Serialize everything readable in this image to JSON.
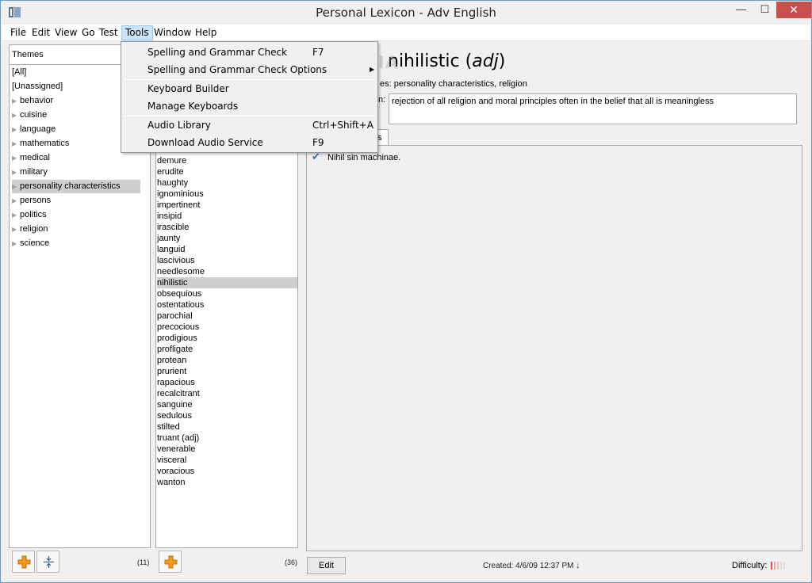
{
  "window": {
    "title": "Personal Lexicon - Adv English",
    "close_glyph": "✕",
    "min_glyph": "—",
    "max_glyph": "☐"
  },
  "menu": [
    "File",
    "Edit",
    "View",
    "Go",
    "Test",
    "Tools",
    "Window",
    "Help"
  ],
  "tools_menu": {
    "items": [
      {
        "label": "Spelling and Grammar Check",
        "shortcut": "F7"
      },
      {
        "label": "Spelling and Grammar Check Options",
        "shortcut": "",
        "submenu": true
      },
      {
        "label": "Keyboard Builder",
        "shortcut": ""
      },
      {
        "label": "Manage Keyboards",
        "shortcut": ""
      },
      {
        "label": "Audio Library",
        "shortcut": "Ctrl+Shift+A"
      },
      {
        "label": "Download Audio Service",
        "shortcut": "F9"
      }
    ],
    "submenu_glyph": "▶"
  },
  "themes_panel": {
    "header": "Themes",
    "items": [
      {
        "label": "[All]",
        "expandable": false
      },
      {
        "label": "[Unassigned]",
        "expandable": false
      },
      {
        "label": "behavior",
        "expandable": true
      },
      {
        "label": "cuisine",
        "expandable": true
      },
      {
        "label": "language",
        "expandable": true
      },
      {
        "label": "mathematics",
        "expandable": true
      },
      {
        "label": "medical",
        "expandable": true
      },
      {
        "label": "military",
        "expandable": true
      },
      {
        "label": "personality characteristics",
        "expandable": true,
        "selected": true
      },
      {
        "label": "persons",
        "expandable": true
      },
      {
        "label": "politics",
        "expandable": true
      },
      {
        "label": "religion",
        "expandable": true
      },
      {
        "label": "science",
        "expandable": true
      }
    ],
    "count": "(11)"
  },
  "words_panel": {
    "items": [
      "demure",
      "erudite",
      "haughty",
      "ignominious",
      "impertinent",
      "insipid",
      "irascible",
      "jaunty",
      "languid",
      "lascivious",
      "needlesome",
      "nihilistic",
      "obsequious",
      "ostentatious",
      "parochial",
      "precocious",
      "prodigious",
      "profligate",
      "protean",
      "prurient",
      "rapacious",
      "recalcitrant",
      "sanguine",
      "sedulous",
      "stilted",
      "truant (adj)",
      "venerable",
      "visceral",
      "voracious",
      "wanton"
    ],
    "selected": "nihilistic",
    "count": "(36)"
  },
  "detail": {
    "word": "nihilistic",
    "pos": "adj",
    "pos_open": "(",
    "pos_close": ")",
    "themes_label": "es:",
    "themes_value": "personality characteristics, religion",
    "definition_label": "n:",
    "definition": "rejection of all religion and moral principles often in the belief that all is meaningless",
    "tab_label": "s",
    "examples": [
      "Nihil sin machinae."
    ],
    "edit_label": "Edit",
    "created": "Created: 4/6/09 12:37 PM ↓",
    "difficulty_label": "Difficulty:"
  },
  "watermark": "SOFTPEDIA",
  "colors": {
    "accent": "#cce4f7",
    "selection": "#cfcfcf",
    "close": "#c7504c",
    "plus": "#f39a1e"
  }
}
